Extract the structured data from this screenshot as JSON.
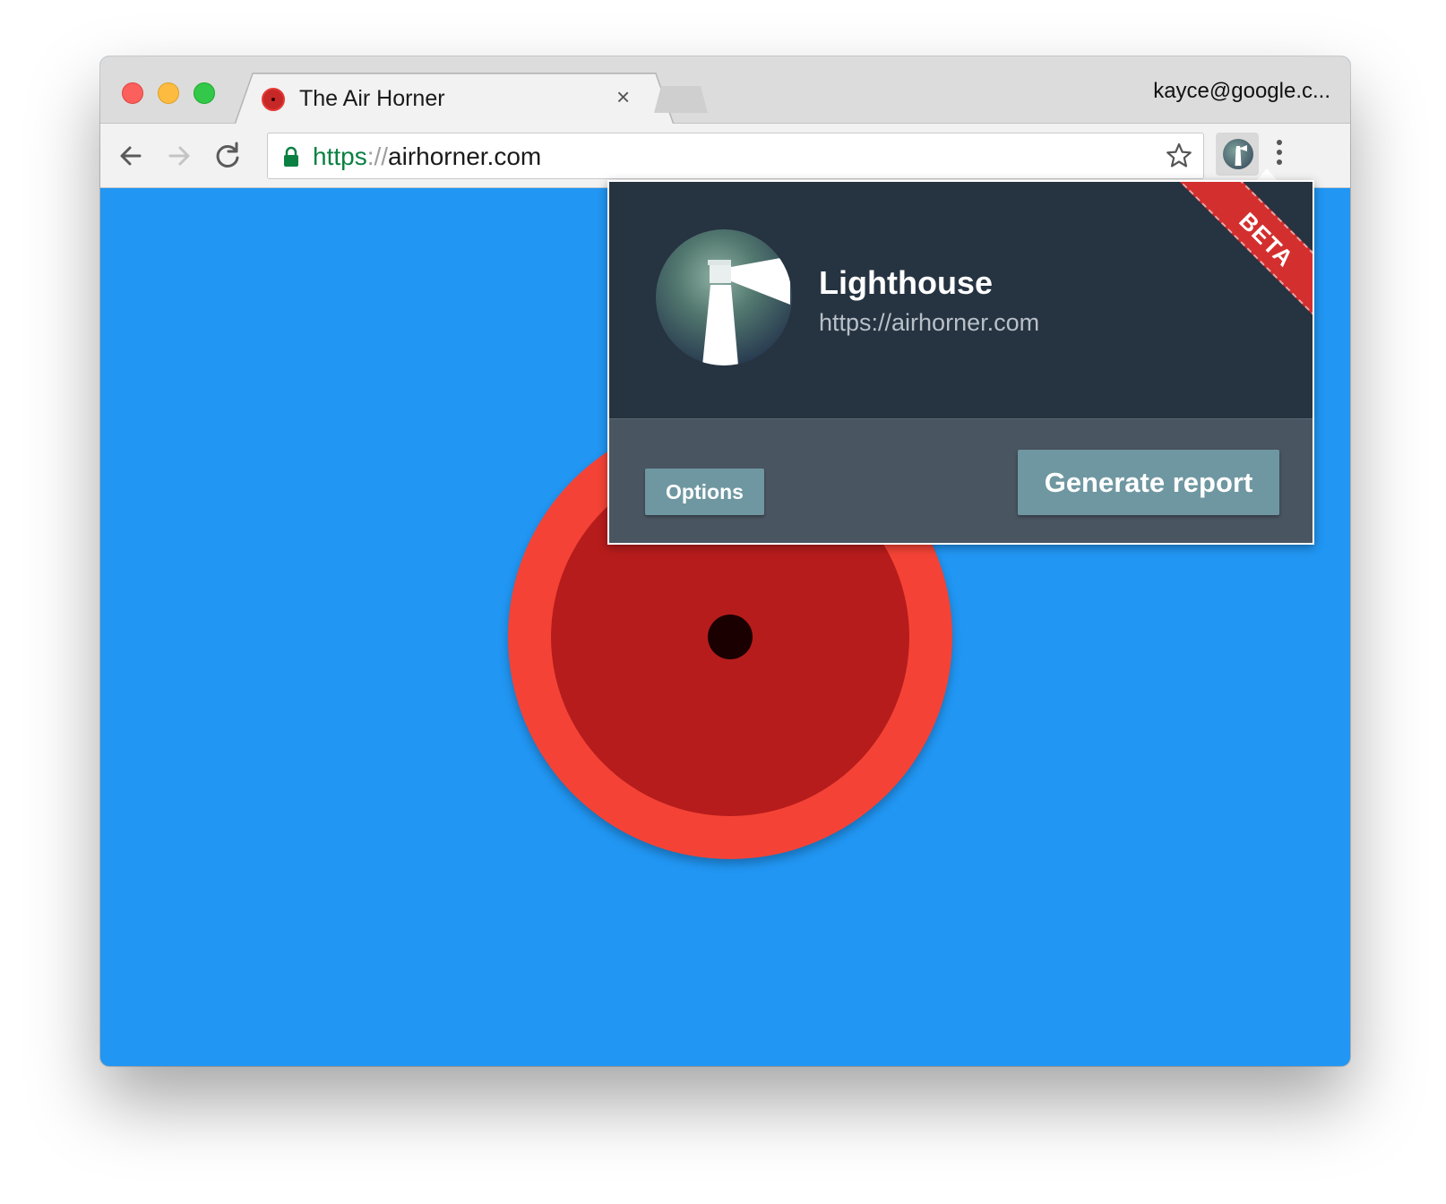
{
  "browser": {
    "tab_title": "The Air Horner",
    "tab_close": "×",
    "profile": "kayce@google.c...",
    "url_scheme": "https",
    "url_separator": "://",
    "url_host": "airhorner.com"
  },
  "popup": {
    "title": "Lighthouse",
    "url": "https://airhorner.com",
    "ribbon": "BETA",
    "options_label": "Options",
    "generate_label": "Generate report"
  },
  "colors": {
    "page_background": "#2196f3",
    "horn_outer": "#f44336",
    "horn_inner": "#b71c1c",
    "popup_header": "#263341",
    "popup_footer": "#4a5562",
    "button": "#6f97a1",
    "ribbon": "#d32f2f",
    "secure_green": "#0b8043"
  },
  "icons": [
    "back-arrow-icon",
    "forward-arrow-icon",
    "reload-icon",
    "lock-icon",
    "star-icon",
    "lighthouse-icon",
    "menu-dots-icon",
    "close-icon"
  ]
}
